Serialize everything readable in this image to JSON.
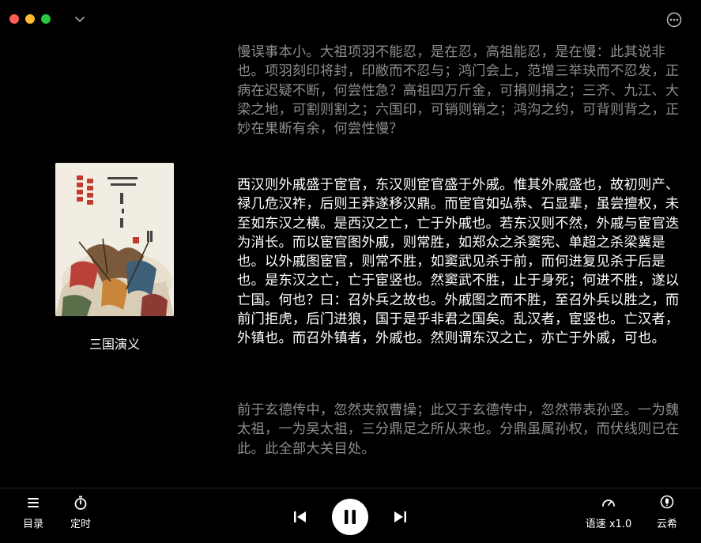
{
  "book": {
    "title": "三国演义"
  },
  "reader": {
    "paragraphs": [
      {
        "style": "dim",
        "text": "慢误事本小。大祖项羽不能忍，是在忍，高祖能忍，是在慢：此其说非也。项羽刻印将封，印敝而不忍与；鸿门会上，范增三举玦而不忍发，正病在迟疑不断，何尝性急？高祖四万斤金，可捐则捐之；三齐、九江、大梁之地，可割则割之；六国印，可销则销之；鸿沟之约，可背则背之，正妙在果断有余，何尝性慢？"
      },
      {
        "style": "bright",
        "text": "西汉则外戚盛于宦官，东汉则宦官盛于外戚。惟其外戚盛也，故初则产、禄几危汉祚，后则王莽遂移汉鼎。而宦官如弘恭、石显辈，虽尝擅权，未至如东汉之横。是西汉之亡，亡于外戚也。若东汉则不然，外戚与宦官迭为消长。而以宦官图外戚，则常胜，如郑众之杀窦宪、单超之杀梁冀是也。以外戚图宦官，则常不胜，如窦武见杀于前，而何进复见杀于后是也。是东汉之亡，亡于宦竖也。然窦武不胜，止于身死；何进不胜，遂以亡国。何也？曰：召外兵之故也。外戚图之而不胜，至召外兵以胜之，而前门拒虎，后门进狼，国于是乎非君之国矣。乱汉者，宦竖也。亡汉者，外镇也。而召外镇者，外戚也。然则谓东汉之亡，亦亡于外戚，可也。"
      },
      {
        "style": "dim",
        "text": "前于玄德传中，忽然夹叙曹操；此又于玄德传中，忽然带表孙坚。一为魏太祖，一为吴太祖，三分鼎足之所从来也。分鼎虽属孙权，而伏线则已在此。此全部大关目处。"
      }
    ]
  },
  "footer": {
    "toc_label": "目录",
    "timer_label": "定时",
    "speed_label": "语速 x1.0",
    "voice_label": "云希"
  }
}
